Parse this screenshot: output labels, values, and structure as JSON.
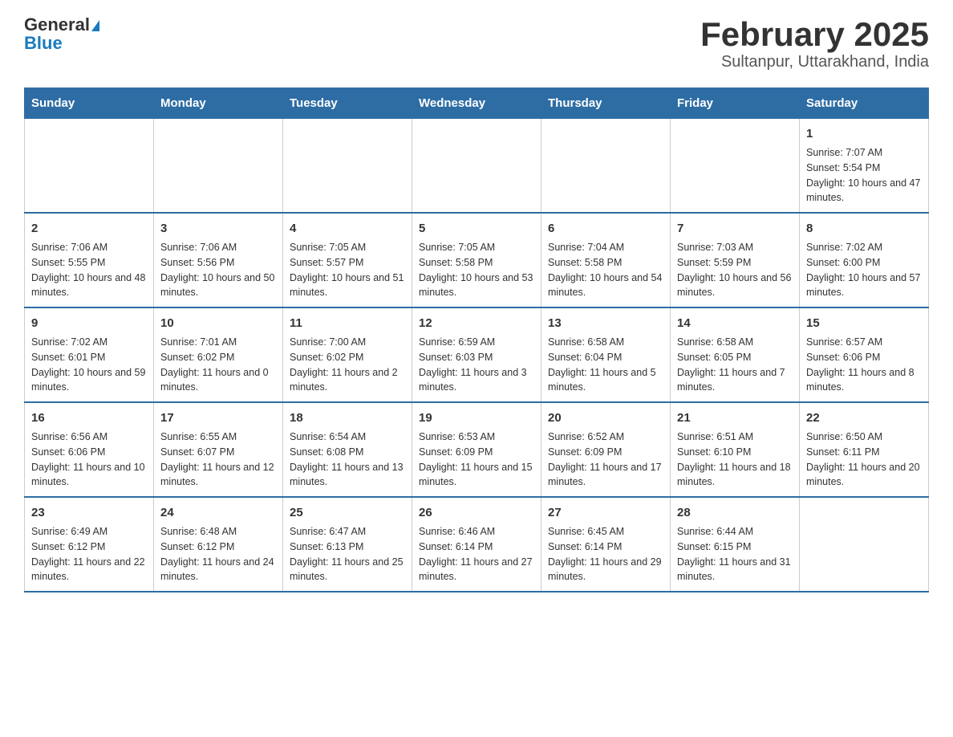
{
  "header": {
    "logo_general": "General",
    "logo_blue": "Blue",
    "title": "February 2025",
    "subtitle": "Sultanpur, Uttarakhand, India"
  },
  "days_of_week": [
    "Sunday",
    "Monday",
    "Tuesday",
    "Wednesday",
    "Thursday",
    "Friday",
    "Saturday"
  ],
  "weeks": [
    [
      {
        "day": "",
        "sunrise": "",
        "sunset": "",
        "daylight": ""
      },
      {
        "day": "",
        "sunrise": "",
        "sunset": "",
        "daylight": ""
      },
      {
        "day": "",
        "sunrise": "",
        "sunset": "",
        "daylight": ""
      },
      {
        "day": "",
        "sunrise": "",
        "sunset": "",
        "daylight": ""
      },
      {
        "day": "",
        "sunrise": "",
        "sunset": "",
        "daylight": ""
      },
      {
        "day": "",
        "sunrise": "",
        "sunset": "",
        "daylight": ""
      },
      {
        "day": "1",
        "sunrise": "Sunrise: 7:07 AM",
        "sunset": "Sunset: 5:54 PM",
        "daylight": "Daylight: 10 hours and 47 minutes."
      }
    ],
    [
      {
        "day": "2",
        "sunrise": "Sunrise: 7:06 AM",
        "sunset": "Sunset: 5:55 PM",
        "daylight": "Daylight: 10 hours and 48 minutes."
      },
      {
        "day": "3",
        "sunrise": "Sunrise: 7:06 AM",
        "sunset": "Sunset: 5:56 PM",
        "daylight": "Daylight: 10 hours and 50 minutes."
      },
      {
        "day": "4",
        "sunrise": "Sunrise: 7:05 AM",
        "sunset": "Sunset: 5:57 PM",
        "daylight": "Daylight: 10 hours and 51 minutes."
      },
      {
        "day": "5",
        "sunrise": "Sunrise: 7:05 AM",
        "sunset": "Sunset: 5:58 PM",
        "daylight": "Daylight: 10 hours and 53 minutes."
      },
      {
        "day": "6",
        "sunrise": "Sunrise: 7:04 AM",
        "sunset": "Sunset: 5:58 PM",
        "daylight": "Daylight: 10 hours and 54 minutes."
      },
      {
        "day": "7",
        "sunrise": "Sunrise: 7:03 AM",
        "sunset": "Sunset: 5:59 PM",
        "daylight": "Daylight: 10 hours and 56 minutes."
      },
      {
        "day": "8",
        "sunrise": "Sunrise: 7:02 AM",
        "sunset": "Sunset: 6:00 PM",
        "daylight": "Daylight: 10 hours and 57 minutes."
      }
    ],
    [
      {
        "day": "9",
        "sunrise": "Sunrise: 7:02 AM",
        "sunset": "Sunset: 6:01 PM",
        "daylight": "Daylight: 10 hours and 59 minutes."
      },
      {
        "day": "10",
        "sunrise": "Sunrise: 7:01 AM",
        "sunset": "Sunset: 6:02 PM",
        "daylight": "Daylight: 11 hours and 0 minutes."
      },
      {
        "day": "11",
        "sunrise": "Sunrise: 7:00 AM",
        "sunset": "Sunset: 6:02 PM",
        "daylight": "Daylight: 11 hours and 2 minutes."
      },
      {
        "day": "12",
        "sunrise": "Sunrise: 6:59 AM",
        "sunset": "Sunset: 6:03 PM",
        "daylight": "Daylight: 11 hours and 3 minutes."
      },
      {
        "day": "13",
        "sunrise": "Sunrise: 6:58 AM",
        "sunset": "Sunset: 6:04 PM",
        "daylight": "Daylight: 11 hours and 5 minutes."
      },
      {
        "day": "14",
        "sunrise": "Sunrise: 6:58 AM",
        "sunset": "Sunset: 6:05 PM",
        "daylight": "Daylight: 11 hours and 7 minutes."
      },
      {
        "day": "15",
        "sunrise": "Sunrise: 6:57 AM",
        "sunset": "Sunset: 6:06 PM",
        "daylight": "Daylight: 11 hours and 8 minutes."
      }
    ],
    [
      {
        "day": "16",
        "sunrise": "Sunrise: 6:56 AM",
        "sunset": "Sunset: 6:06 PM",
        "daylight": "Daylight: 11 hours and 10 minutes."
      },
      {
        "day": "17",
        "sunrise": "Sunrise: 6:55 AM",
        "sunset": "Sunset: 6:07 PM",
        "daylight": "Daylight: 11 hours and 12 minutes."
      },
      {
        "day": "18",
        "sunrise": "Sunrise: 6:54 AM",
        "sunset": "Sunset: 6:08 PM",
        "daylight": "Daylight: 11 hours and 13 minutes."
      },
      {
        "day": "19",
        "sunrise": "Sunrise: 6:53 AM",
        "sunset": "Sunset: 6:09 PM",
        "daylight": "Daylight: 11 hours and 15 minutes."
      },
      {
        "day": "20",
        "sunrise": "Sunrise: 6:52 AM",
        "sunset": "Sunset: 6:09 PM",
        "daylight": "Daylight: 11 hours and 17 minutes."
      },
      {
        "day": "21",
        "sunrise": "Sunrise: 6:51 AM",
        "sunset": "Sunset: 6:10 PM",
        "daylight": "Daylight: 11 hours and 18 minutes."
      },
      {
        "day": "22",
        "sunrise": "Sunrise: 6:50 AM",
        "sunset": "Sunset: 6:11 PM",
        "daylight": "Daylight: 11 hours and 20 minutes."
      }
    ],
    [
      {
        "day": "23",
        "sunrise": "Sunrise: 6:49 AM",
        "sunset": "Sunset: 6:12 PM",
        "daylight": "Daylight: 11 hours and 22 minutes."
      },
      {
        "day": "24",
        "sunrise": "Sunrise: 6:48 AM",
        "sunset": "Sunset: 6:12 PM",
        "daylight": "Daylight: 11 hours and 24 minutes."
      },
      {
        "day": "25",
        "sunrise": "Sunrise: 6:47 AM",
        "sunset": "Sunset: 6:13 PM",
        "daylight": "Daylight: 11 hours and 25 minutes."
      },
      {
        "day": "26",
        "sunrise": "Sunrise: 6:46 AM",
        "sunset": "Sunset: 6:14 PM",
        "daylight": "Daylight: 11 hours and 27 minutes."
      },
      {
        "day": "27",
        "sunrise": "Sunrise: 6:45 AM",
        "sunset": "Sunset: 6:14 PM",
        "daylight": "Daylight: 11 hours and 29 minutes."
      },
      {
        "day": "28",
        "sunrise": "Sunrise: 6:44 AM",
        "sunset": "Sunset: 6:15 PM",
        "daylight": "Daylight: 11 hours and 31 minutes."
      },
      {
        "day": "",
        "sunrise": "",
        "sunset": "",
        "daylight": ""
      }
    ]
  ]
}
